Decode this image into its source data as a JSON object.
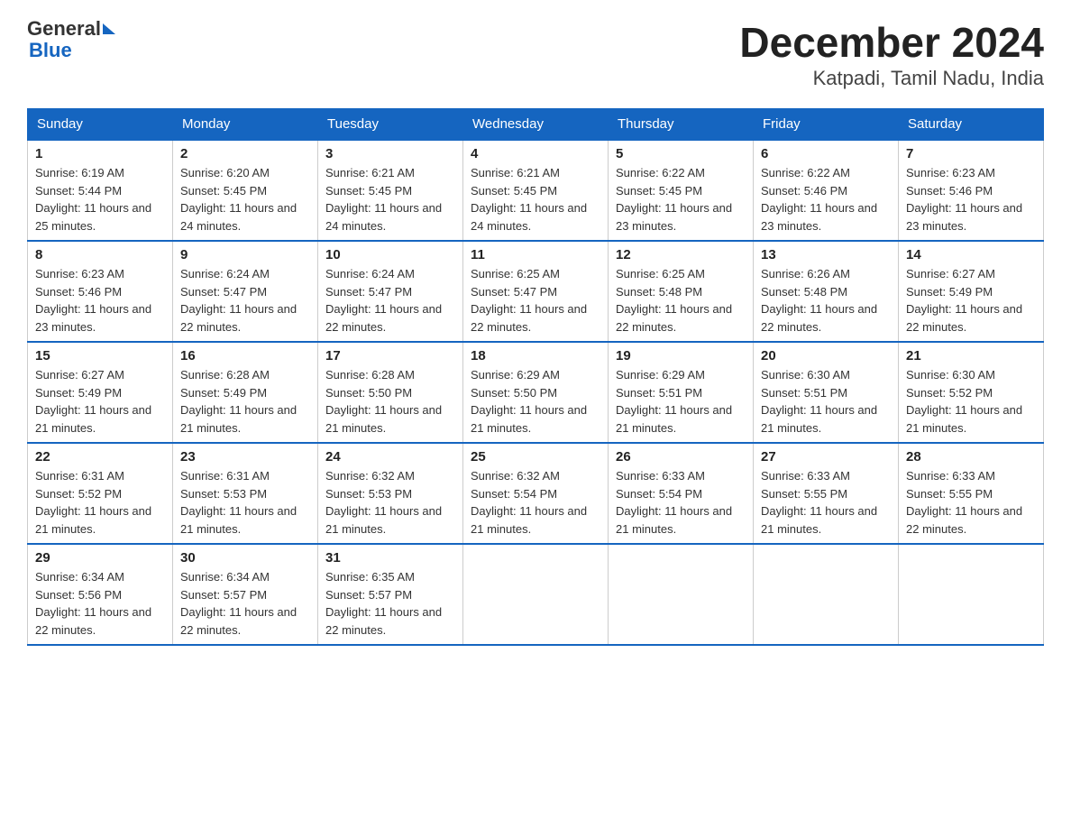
{
  "header": {
    "logo_general": "General",
    "logo_blue": "Blue",
    "title": "December 2024",
    "subtitle": "Katpadi, Tamil Nadu, India"
  },
  "days_of_week": [
    "Sunday",
    "Monday",
    "Tuesday",
    "Wednesday",
    "Thursday",
    "Friday",
    "Saturday"
  ],
  "weeks": [
    [
      {
        "day": "1",
        "sunrise": "6:19 AM",
        "sunset": "5:44 PM",
        "daylight": "11 hours and 25 minutes."
      },
      {
        "day": "2",
        "sunrise": "6:20 AM",
        "sunset": "5:45 PM",
        "daylight": "11 hours and 24 minutes."
      },
      {
        "day": "3",
        "sunrise": "6:21 AM",
        "sunset": "5:45 PM",
        "daylight": "11 hours and 24 minutes."
      },
      {
        "day": "4",
        "sunrise": "6:21 AM",
        "sunset": "5:45 PM",
        "daylight": "11 hours and 24 minutes."
      },
      {
        "day": "5",
        "sunrise": "6:22 AM",
        "sunset": "5:45 PM",
        "daylight": "11 hours and 23 minutes."
      },
      {
        "day": "6",
        "sunrise": "6:22 AM",
        "sunset": "5:46 PM",
        "daylight": "11 hours and 23 minutes."
      },
      {
        "day": "7",
        "sunrise": "6:23 AM",
        "sunset": "5:46 PM",
        "daylight": "11 hours and 23 minutes."
      }
    ],
    [
      {
        "day": "8",
        "sunrise": "6:23 AM",
        "sunset": "5:46 PM",
        "daylight": "11 hours and 23 minutes."
      },
      {
        "day": "9",
        "sunrise": "6:24 AM",
        "sunset": "5:47 PM",
        "daylight": "11 hours and 22 minutes."
      },
      {
        "day": "10",
        "sunrise": "6:24 AM",
        "sunset": "5:47 PM",
        "daylight": "11 hours and 22 minutes."
      },
      {
        "day": "11",
        "sunrise": "6:25 AM",
        "sunset": "5:47 PM",
        "daylight": "11 hours and 22 minutes."
      },
      {
        "day": "12",
        "sunrise": "6:25 AM",
        "sunset": "5:48 PM",
        "daylight": "11 hours and 22 minutes."
      },
      {
        "day": "13",
        "sunrise": "6:26 AM",
        "sunset": "5:48 PM",
        "daylight": "11 hours and 22 minutes."
      },
      {
        "day": "14",
        "sunrise": "6:27 AM",
        "sunset": "5:49 PM",
        "daylight": "11 hours and 22 minutes."
      }
    ],
    [
      {
        "day": "15",
        "sunrise": "6:27 AM",
        "sunset": "5:49 PM",
        "daylight": "11 hours and 21 minutes."
      },
      {
        "day": "16",
        "sunrise": "6:28 AM",
        "sunset": "5:49 PM",
        "daylight": "11 hours and 21 minutes."
      },
      {
        "day": "17",
        "sunrise": "6:28 AM",
        "sunset": "5:50 PM",
        "daylight": "11 hours and 21 minutes."
      },
      {
        "day": "18",
        "sunrise": "6:29 AM",
        "sunset": "5:50 PM",
        "daylight": "11 hours and 21 minutes."
      },
      {
        "day": "19",
        "sunrise": "6:29 AM",
        "sunset": "5:51 PM",
        "daylight": "11 hours and 21 minutes."
      },
      {
        "day": "20",
        "sunrise": "6:30 AM",
        "sunset": "5:51 PM",
        "daylight": "11 hours and 21 minutes."
      },
      {
        "day": "21",
        "sunrise": "6:30 AM",
        "sunset": "5:52 PM",
        "daylight": "11 hours and 21 minutes."
      }
    ],
    [
      {
        "day": "22",
        "sunrise": "6:31 AM",
        "sunset": "5:52 PM",
        "daylight": "11 hours and 21 minutes."
      },
      {
        "day": "23",
        "sunrise": "6:31 AM",
        "sunset": "5:53 PM",
        "daylight": "11 hours and 21 minutes."
      },
      {
        "day": "24",
        "sunrise": "6:32 AM",
        "sunset": "5:53 PM",
        "daylight": "11 hours and 21 minutes."
      },
      {
        "day": "25",
        "sunrise": "6:32 AM",
        "sunset": "5:54 PM",
        "daylight": "11 hours and 21 minutes."
      },
      {
        "day": "26",
        "sunrise": "6:33 AM",
        "sunset": "5:54 PM",
        "daylight": "11 hours and 21 minutes."
      },
      {
        "day": "27",
        "sunrise": "6:33 AM",
        "sunset": "5:55 PM",
        "daylight": "11 hours and 21 minutes."
      },
      {
        "day": "28",
        "sunrise": "6:33 AM",
        "sunset": "5:55 PM",
        "daylight": "11 hours and 22 minutes."
      }
    ],
    [
      {
        "day": "29",
        "sunrise": "6:34 AM",
        "sunset": "5:56 PM",
        "daylight": "11 hours and 22 minutes."
      },
      {
        "day": "30",
        "sunrise": "6:34 AM",
        "sunset": "5:57 PM",
        "daylight": "11 hours and 22 minutes."
      },
      {
        "day": "31",
        "sunrise": "6:35 AM",
        "sunset": "5:57 PM",
        "daylight": "11 hours and 22 minutes."
      },
      null,
      null,
      null,
      null
    ]
  ]
}
